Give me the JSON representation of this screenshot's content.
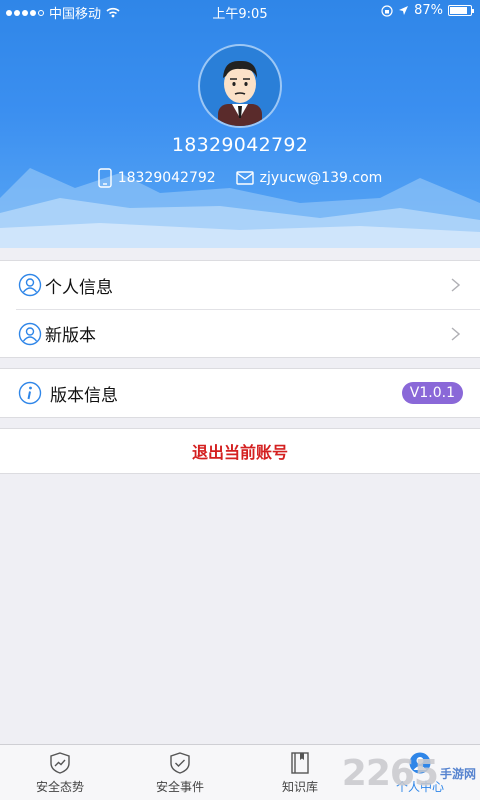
{
  "status_bar": {
    "carrier": "中国移动",
    "time": "上午9:05",
    "battery": "87%",
    "battery_level": 0.87
  },
  "profile": {
    "username": "18329042792",
    "phone": "18329042792",
    "email": "zjyucw@139.com"
  },
  "menu": {
    "personal_info": "个人信息",
    "new_version": "新版本",
    "version_info": "版本信息",
    "version_value": "V1.0.1"
  },
  "logout_label": "退出当前账号",
  "tabs": [
    {
      "label": "安全态势",
      "icon": "shield-chart-icon"
    },
    {
      "label": "安全事件",
      "icon": "shield-check-icon"
    },
    {
      "label": "知识库",
      "icon": "book-icon"
    },
    {
      "label": "个人中心",
      "icon": "person-icon"
    }
  ],
  "watermark": {
    "number": "2265",
    "text": "手游网"
  },
  "colors": {
    "header_blue": "#2f86e8",
    "badge_purple": "#8a68d8",
    "logout_red": "#d42020",
    "active_tab": "#2f86e8"
  }
}
